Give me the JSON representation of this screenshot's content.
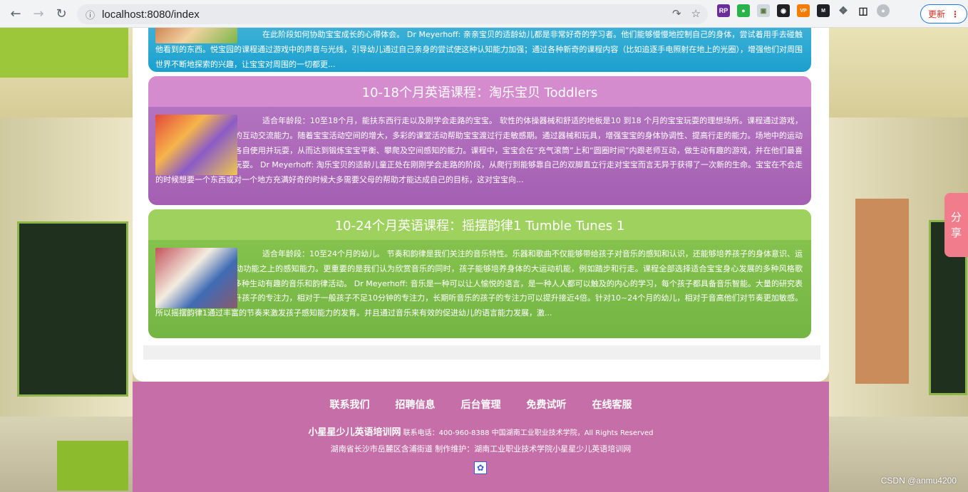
{
  "browser": {
    "url": "localhost:8080/index",
    "update_label": "更新",
    "colors": {
      "toolbar": "#f1f3f4",
      "accent": "#1a73e8"
    }
  },
  "courses": [
    {
      "title": "",
      "text": "在此阶段如何协助宝宝成长的心得体会。 Dr Meyerhoff: 亲亲宝贝的适龄幼儿都是非常好奇的学习者。他们能够慢慢地控制自己的身体，尝试着用手去碰触他看到的东西。悦宝园的课程通过游戏中的声音与光线，引导幼儿通过自己亲身的尝试使这种认知能力加强；通过各种新奇的课程内容（比如追逐手电照射在地上的光圈），增强他们对周围世界不断地探索的兴趣，让宝宝对周围的一切都更...",
      "color": "#1aa0cf"
    },
    {
      "title": "10-18个月英语课程：淘乐宝贝 Toddlers",
      "text": "适合年龄段：10至18个月，能扶东西行走以及刚学会走路的宝宝。 软性的体操器械和舒适的地板是10 到18 个月的宝宝玩耍的理想场所。课程通过游戏，音乐和阅读，培养孩子的互动交流能力。随着宝宝活动空间的增大，多彩的课堂活动帮助宝宝渡过行走敏感期。通过器械和玩具，增强宝宝的身体协调性、提高行走的能力。场地中的运动器械摆放位置适合宝宝各自使用并玩耍，从而达到锻炼宝宝平衡、攀爬及空间感知的能力。课程中，宝宝会在“充气滚筒”上和“圆圈时间”内跟老师互动，做生动有趣的游戏，并在他们最喜爱的“泡泡舞会”中尽情玩耍。 Dr Meyerhoff: 淘乐宝贝的适龄儿童正处在刚刚学会走路的阶段，从爬行到能够靠自己的双脚直立行走对宝宝而言无异于获得了一次新的生命。宝宝在不会走的时候想要一个东西或对一个地方充满好奇的时候大多需要父母的帮助才能达成自己的目标，这对宝宝向...",
      "color": "#a45fb2"
    },
    {
      "title": "10-24个月英语课程：摇摆韵律1 Tumble Tunes 1",
      "text": "适合年龄段：10至24个月的幼儿。 节奏和韵律是我们关注的音乐特性。乐器和歌曲不仅能够带给孩子对音乐的感知和认识，还能够培养孩子的身体意识、运动意识，以及建立在运动功能之上的感知能力。更重要的是我们认为欣赏音乐的同时，孩子能够培养身体的大运动机能，例如踏步和行走。课程全部选择适合宝宝身心发展的多种风格歌曲。老师带领宝宝开展多种生动有趣的音乐和韵律活动。 Dr Meyerhoff: 音乐是一种可以让人愉悦的语言，是一种人人都可以触及的内心的学习，每个孩子都具备音乐智能。大量的研究表明，音乐可以有效的提升孩子的专注力，相对于一般孩子不足10分钟的专注力，长期听音乐的孩子的专注力可以提升接近4倍。针对10~24个月的幼儿，相对于音高他们对节奏更加敏感。所以摇摆韵律1通过丰富的节奏来激发孩子感知能力的发育。并且通过音乐来有效的促进幼儿的语言能力发展，激...",
      "color": "#74b544"
    }
  ],
  "footer": {
    "nav": [
      "联系我们",
      "招聘信息",
      "后台管理",
      "免费试听",
      "在线客服"
    ],
    "brand": "小星星少儿英语培训网",
    "contact": "联系电话：400-960-8388 中国湖南工业职业技术学院，All Rights Reserved",
    "address": "湖南省长沙市岳麓区含浦街道 制作维护：湖南工业职业技术学院小星星少儿英语培训网",
    "badge_icon": "paw-icon",
    "color": "#c66ea8"
  },
  "share": {
    "label_1": "分",
    "label_2": "享"
  },
  "watermark": "CSDN @anmu4200"
}
